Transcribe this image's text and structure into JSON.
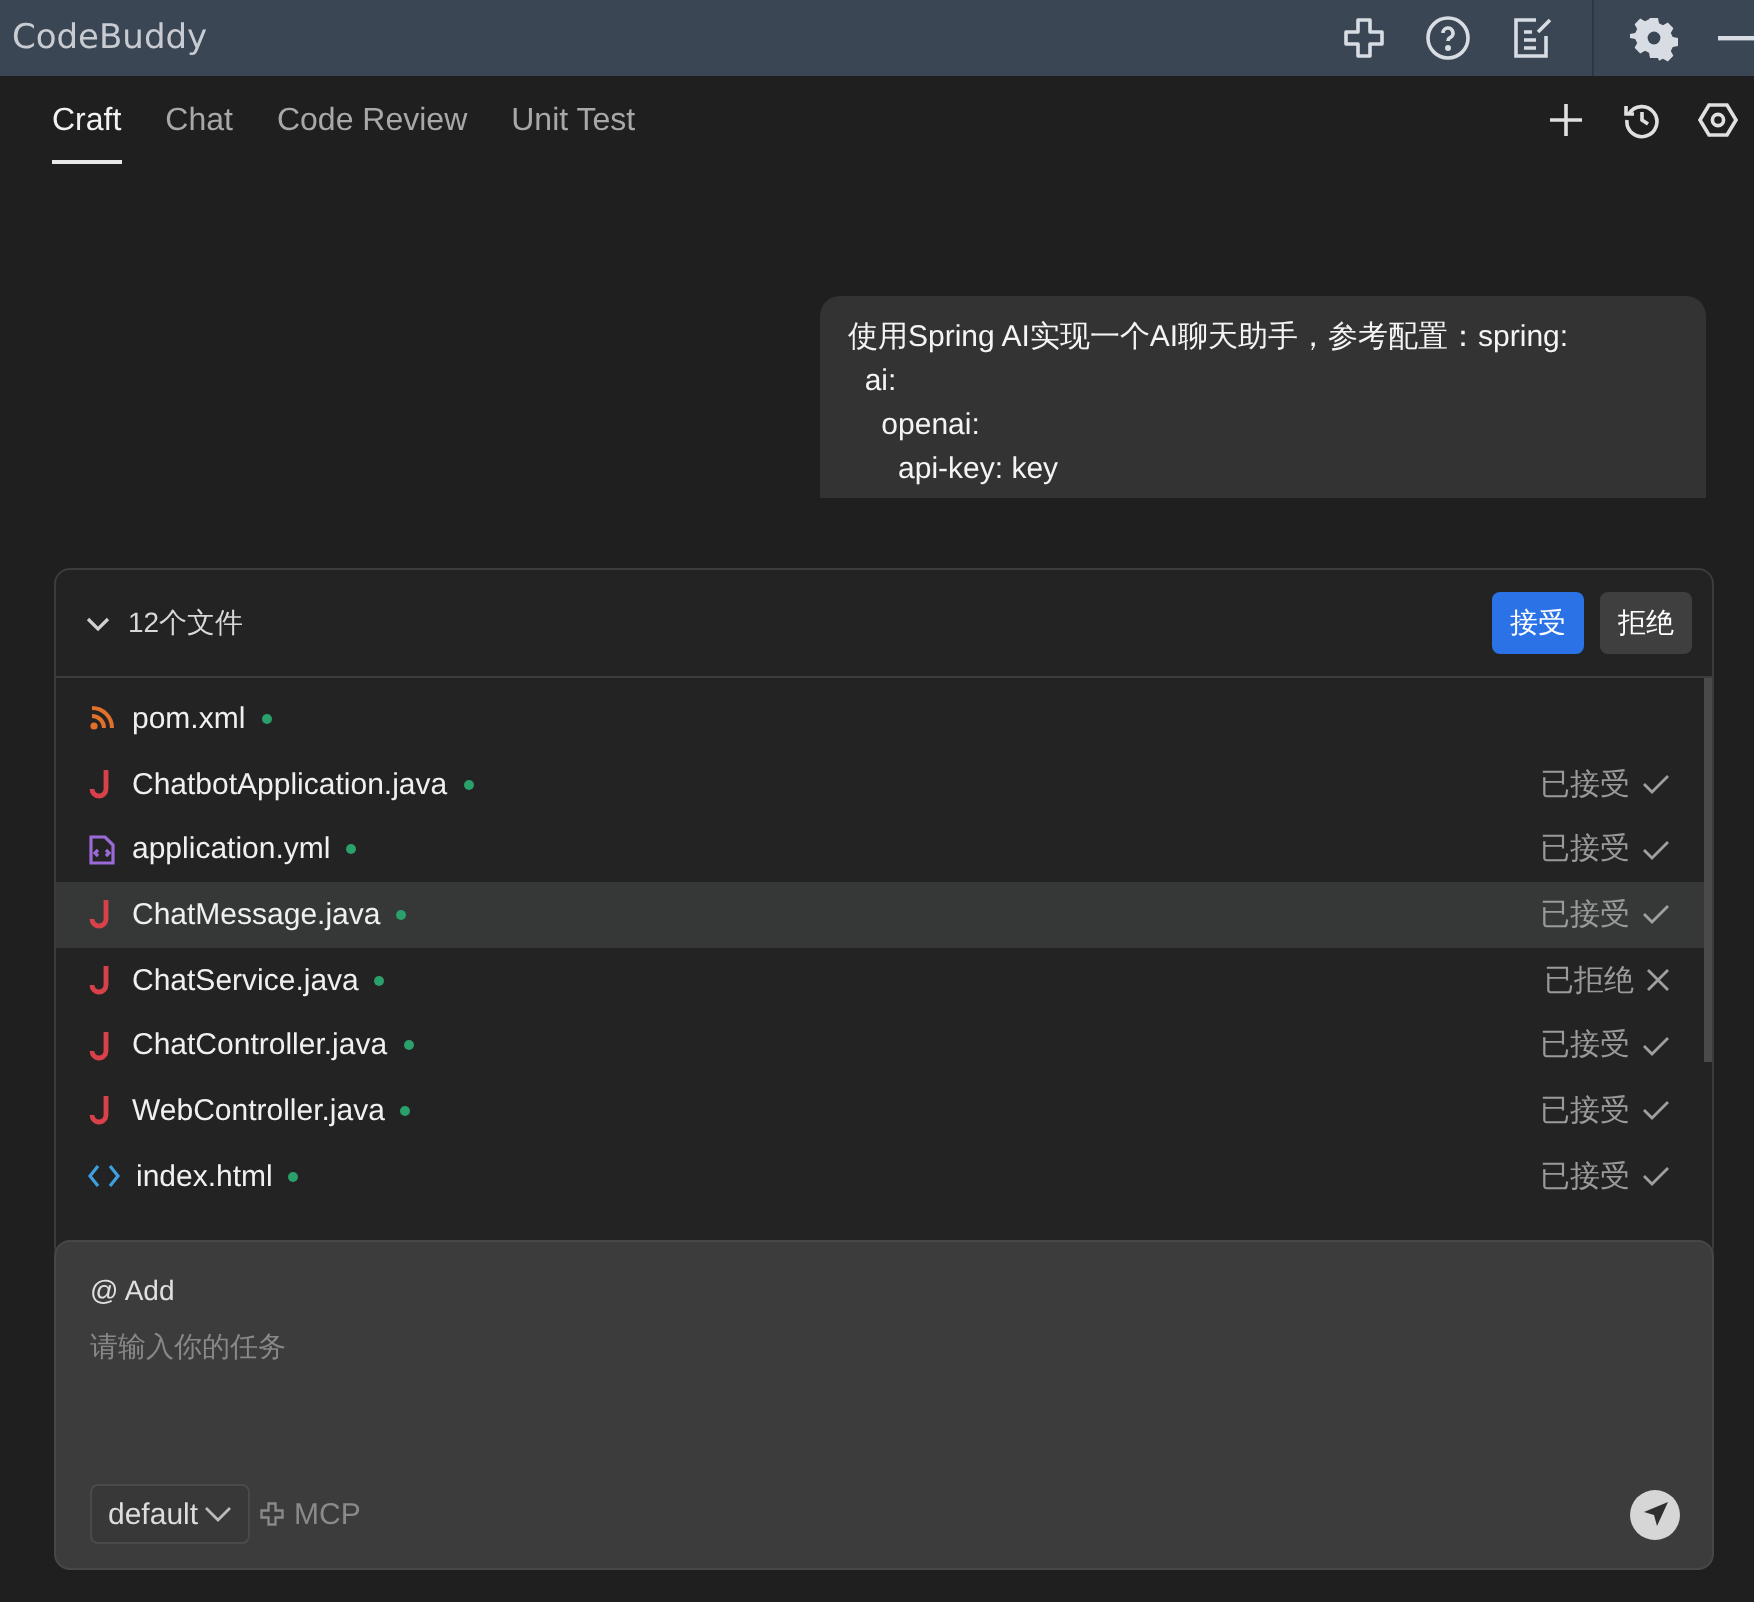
{
  "window": {
    "title": "CodeBuddy"
  },
  "tabs": [
    {
      "label": "Craft",
      "selected": true
    },
    {
      "label": "Chat",
      "selected": false
    },
    {
      "label": "Code Review",
      "selected": false
    },
    {
      "label": "Unit Test",
      "selected": false
    }
  ],
  "message": {
    "text": "使用Spring AI实现一个AI聊天助手，参考配置：spring:\n  ai:\n    openai:\n      api-key: key"
  },
  "changes": {
    "title": "12个文件",
    "expanded": true,
    "accept_label": "接受",
    "reject_label": "拒绝",
    "files": [
      {
        "name": "pom.xml",
        "kind": "rss",
        "modified": true,
        "selected": false
      },
      {
        "name": "ChatbotApplication.java",
        "kind": "java",
        "modified": true,
        "selected": false,
        "accepted": true,
        "status_label": "已接受"
      },
      {
        "name": "application.yml",
        "kind": "config",
        "modified": true,
        "selected": false,
        "accepted": true,
        "status_label": "已接受"
      },
      {
        "name": "ChatMessage.java",
        "kind": "java",
        "modified": true,
        "selected": true,
        "accepted": true,
        "status_label": "已接受"
      },
      {
        "name": "ChatService.java",
        "kind": "java",
        "modified": true,
        "selected": false,
        "accepted": false,
        "status_label": "已拒绝"
      },
      {
        "name": "ChatController.java",
        "kind": "java",
        "modified": true,
        "selected": false,
        "accepted": true,
        "status_label": "已接受"
      },
      {
        "name": "WebController.java",
        "kind": "java",
        "modified": true,
        "selected": false,
        "accepted": true,
        "status_label": "已接受"
      },
      {
        "name": "index.html",
        "kind": "html",
        "modified": true,
        "selected": false,
        "accepted": true,
        "status_label": "已接受"
      }
    ]
  },
  "composer": {
    "add_label": "@ Add",
    "placeholder": "请输入你的任务",
    "mode": "default",
    "mcp_label": "MCP"
  }
}
